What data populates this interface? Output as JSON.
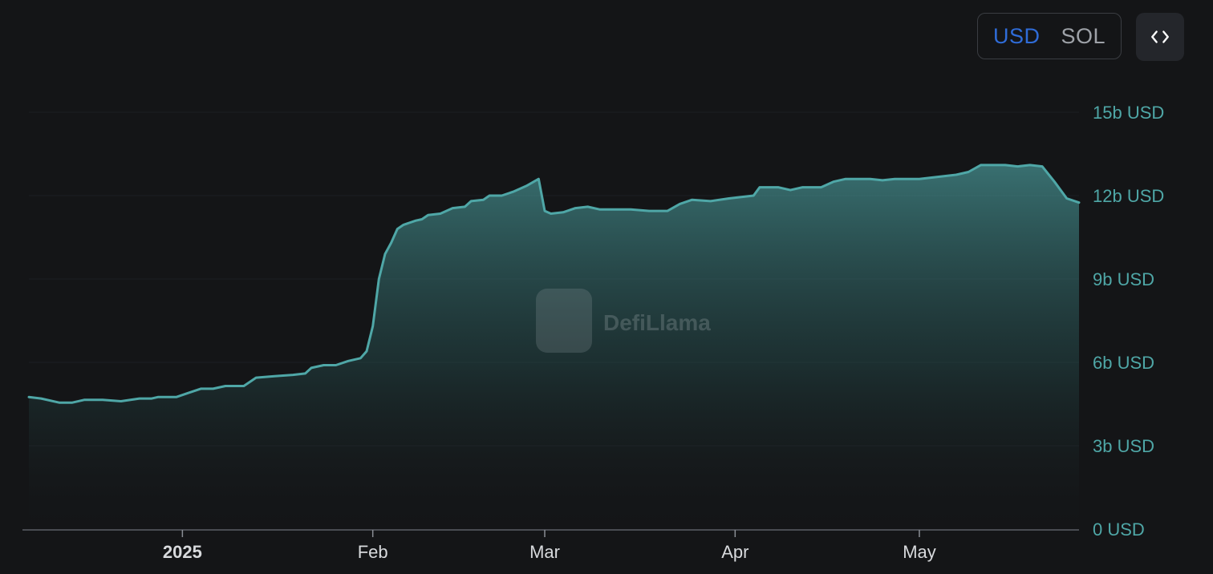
{
  "currency_toggle": {
    "options": [
      {
        "label": "USD",
        "active": true
      },
      {
        "label": "SOL",
        "active": false
      }
    ]
  },
  "embed_button": {
    "icon": "code-icon"
  },
  "watermark": {
    "text": "DefiLlama"
  },
  "colors": {
    "background": "#141517",
    "line": "#4fa7a7",
    "axis_text": "#4fa7a7",
    "active_toggle": "#2f6cd8"
  },
  "chart_data": {
    "type": "area",
    "title": "",
    "xlabel": "",
    "ylabel": "",
    "y_unit": "b USD",
    "ylim": [
      0,
      15
    ],
    "yticks": [
      {
        "value": 0,
        "label": "0 USD"
      },
      {
        "value": 3,
        "label": "3b USD"
      },
      {
        "value": 6,
        "label": "6b USD"
      },
      {
        "value": 9,
        "label": "9b USD"
      },
      {
        "value": 12,
        "label": "12b USD"
      },
      {
        "value": 15,
        "label": "15b USD"
      }
    ],
    "xlim": [
      "2024-12-07",
      "2025-05-12"
    ],
    "xticks": [
      {
        "date": "2025-01-01",
        "label": "2025",
        "bold": true
      },
      {
        "date": "2025-02-01",
        "label": "Feb",
        "bold": false
      },
      {
        "date": "2025-03-01",
        "label": "Mar",
        "bold": false
      },
      {
        "date": "2025-04-01",
        "label": "Apr",
        "bold": false
      },
      {
        "date": "2025-05-01",
        "label": "May",
        "bold": false
      }
    ],
    "grid": true,
    "series": [
      {
        "values": [
          [
            "2024-12-07",
            4.75
          ],
          [
            "2024-12-09",
            4.7
          ],
          [
            "2024-12-12",
            4.55
          ],
          [
            "2024-12-14",
            4.55
          ],
          [
            "2024-12-16",
            4.65
          ],
          [
            "2024-12-19",
            4.65
          ],
          [
            "2024-12-22",
            4.6
          ],
          [
            "2024-12-25",
            4.7
          ],
          [
            "2024-12-27",
            4.7
          ],
          [
            "2024-12-28",
            4.75
          ],
          [
            "2024-12-31",
            4.75
          ],
          [
            "2025-01-02",
            4.9
          ],
          [
            "2025-01-04",
            5.05
          ],
          [
            "2025-01-06",
            5.05
          ],
          [
            "2025-01-08",
            5.15
          ],
          [
            "2025-01-11",
            5.15
          ],
          [
            "2025-01-13",
            5.45
          ],
          [
            "2025-01-16",
            5.5
          ],
          [
            "2025-01-19",
            5.55
          ],
          [
            "2025-01-21",
            5.6
          ],
          [
            "2025-01-22",
            5.8
          ],
          [
            "2025-01-24",
            5.9
          ],
          [
            "2025-01-26",
            5.9
          ],
          [
            "2025-01-28",
            6.05
          ],
          [
            "2025-01-30",
            6.15
          ],
          [
            "2025-01-31",
            6.4
          ],
          [
            "2025-02-01",
            7.3
          ],
          [
            "2025-02-02",
            9.0
          ],
          [
            "2025-02-03",
            9.9
          ],
          [
            "2025-02-04",
            10.3
          ],
          [
            "2025-02-05",
            10.8
          ],
          [
            "2025-02-06",
            10.95
          ],
          [
            "2025-02-08",
            11.1
          ],
          [
            "2025-02-09",
            11.15
          ],
          [
            "2025-02-10",
            11.3
          ],
          [
            "2025-02-12",
            11.35
          ],
          [
            "2025-02-14",
            11.55
          ],
          [
            "2025-02-16",
            11.6
          ],
          [
            "2025-02-17",
            11.8
          ],
          [
            "2025-02-19",
            11.85
          ],
          [
            "2025-02-20",
            12.0
          ],
          [
            "2025-02-22",
            12.0
          ],
          [
            "2025-02-24",
            12.15
          ],
          [
            "2025-02-26",
            12.35
          ],
          [
            "2025-02-28",
            12.6
          ],
          [
            "2025-03-01",
            11.45
          ],
          [
            "2025-03-02",
            11.35
          ],
          [
            "2025-03-04",
            11.4
          ],
          [
            "2025-03-06",
            11.55
          ],
          [
            "2025-03-08",
            11.6
          ],
          [
            "2025-03-10",
            11.5
          ],
          [
            "2025-03-12",
            11.5
          ],
          [
            "2025-03-15",
            11.5
          ],
          [
            "2025-03-18",
            11.45
          ],
          [
            "2025-03-21",
            11.45
          ],
          [
            "2025-03-23",
            11.7
          ],
          [
            "2025-03-25",
            11.85
          ],
          [
            "2025-03-28",
            11.8
          ],
          [
            "2025-03-31",
            11.9
          ],
          [
            "2025-04-02",
            11.95
          ],
          [
            "2025-04-04",
            12.0
          ],
          [
            "2025-04-05",
            12.3
          ],
          [
            "2025-04-08",
            12.3
          ],
          [
            "2025-04-10",
            12.2
          ],
          [
            "2025-04-12",
            12.3
          ],
          [
            "2025-04-15",
            12.3
          ],
          [
            "2025-04-17",
            12.5
          ],
          [
            "2025-04-19",
            12.6
          ],
          [
            "2025-04-21",
            12.6
          ],
          [
            "2025-04-23",
            12.6
          ],
          [
            "2025-04-25",
            12.55
          ],
          [
            "2025-04-27",
            12.6
          ],
          [
            "2025-04-29",
            12.6
          ],
          [
            "2025-05-01",
            12.6
          ],
          [
            "2025-05-03",
            12.65
          ],
          [
            "2025-05-05",
            12.7
          ],
          [
            "2025-05-07",
            12.75
          ],
          [
            "2025-05-09",
            12.85
          ],
          [
            "2025-05-11",
            13.1
          ],
          [
            "2025-05-13",
            13.1
          ],
          [
            "2025-05-15",
            13.1
          ],
          [
            "2025-05-17",
            13.05
          ],
          [
            "2025-05-19",
            13.1
          ],
          [
            "2025-05-21",
            13.05
          ],
          [
            "2025-05-23",
            12.5
          ],
          [
            "2025-05-25",
            11.9
          ],
          [
            "2025-05-27",
            11.75
          ]
        ]
      }
    ]
  }
}
